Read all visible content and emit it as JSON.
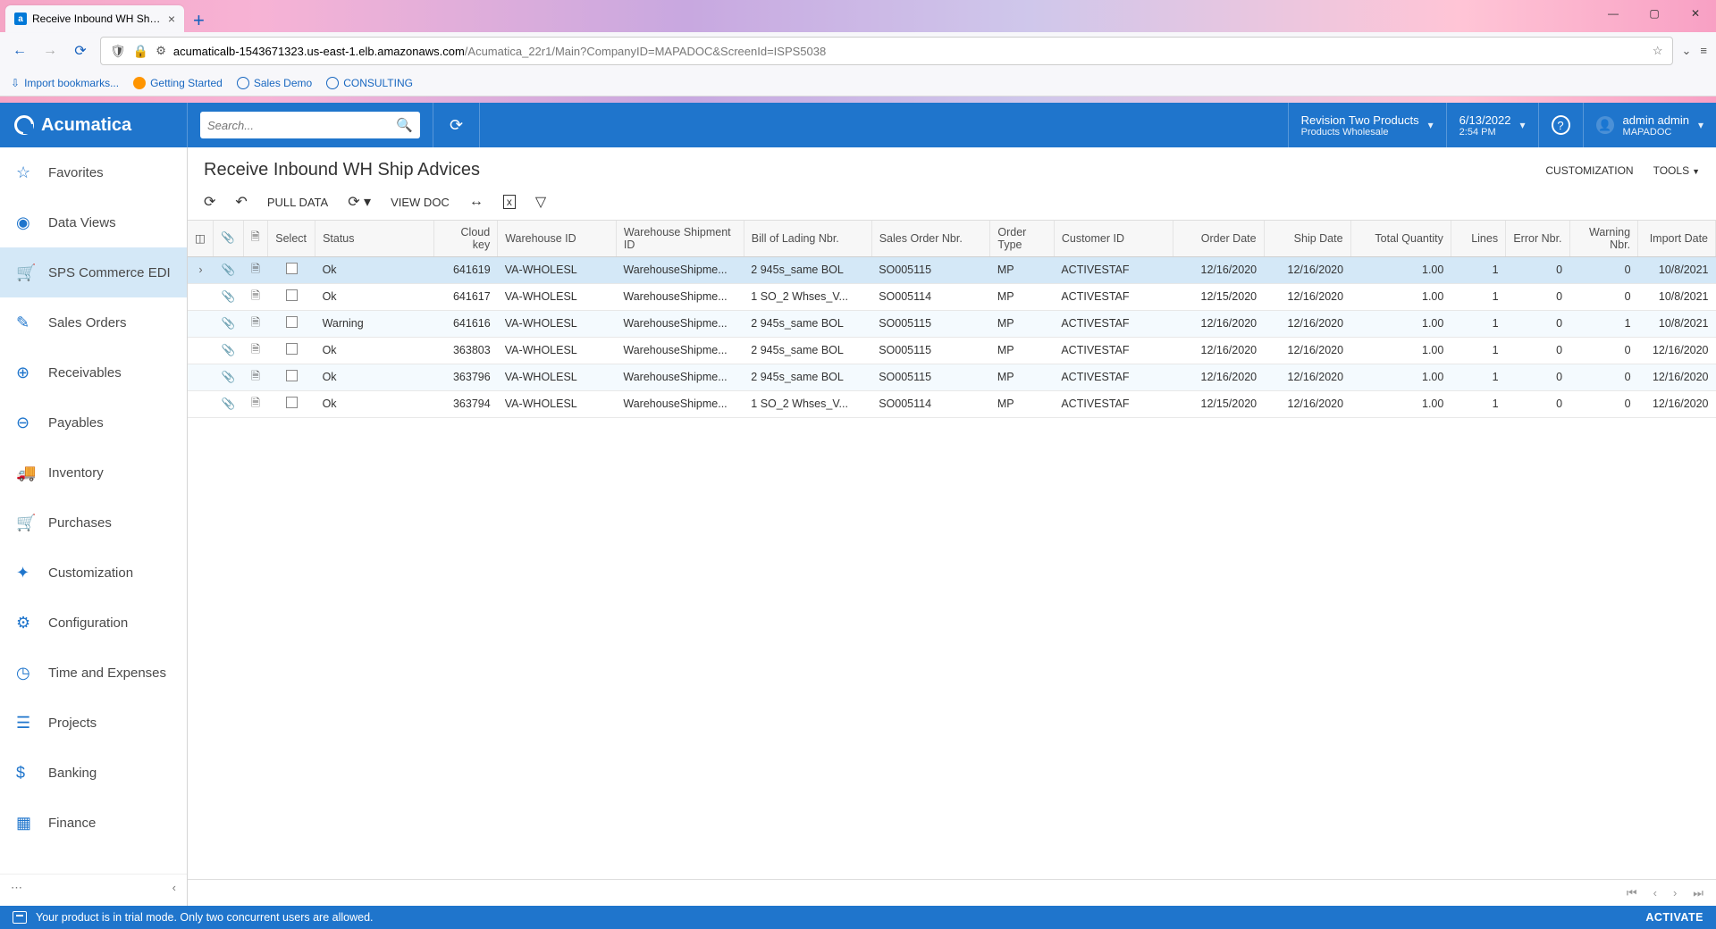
{
  "browser": {
    "tab_title": "Receive Inbound WH Ship Advi",
    "url_prefix": "acumaticalb-1543671323.us-east-1.elb.amazonaws.com",
    "url_path": "/Acumatica_22r1/Main?CompanyID=MAPADOC&ScreenId=ISPS5038",
    "bookmarks": {
      "import": "Import bookmarks...",
      "getting_started": "Getting Started",
      "sales_demo": "Sales Demo",
      "consulting": "CONSULTING"
    }
  },
  "header": {
    "logo_text": "Acumatica",
    "search_placeholder": "Search...",
    "tenant_line1": "Revision Two Products",
    "tenant_line2": "Products Wholesale",
    "date": "6/13/2022",
    "time": "2:54 PM",
    "user_line1": "admin admin",
    "user_line2": "MAPADOC"
  },
  "sidebar": {
    "items": [
      {
        "label": "Favorites",
        "icon": "star"
      },
      {
        "label": "Data Views",
        "icon": "eye"
      },
      {
        "label": "SPS Commerce EDI",
        "icon": "cart",
        "active": true
      },
      {
        "label": "Sales Orders",
        "icon": "doc"
      },
      {
        "label": "Receivables",
        "icon": "plus"
      },
      {
        "label": "Payables",
        "icon": "minus"
      },
      {
        "label": "Inventory",
        "icon": "truck"
      },
      {
        "label": "Purchases",
        "icon": "cart2"
      },
      {
        "label": "Customization",
        "icon": "puzzle"
      },
      {
        "label": "Configuration",
        "icon": "gear"
      },
      {
        "label": "Time and Expenses",
        "icon": "clock"
      },
      {
        "label": "Projects",
        "icon": "stack"
      },
      {
        "label": "Banking",
        "icon": "dollar"
      },
      {
        "label": "Finance",
        "icon": "calc"
      }
    ]
  },
  "page": {
    "title": "Receive Inbound WH Ship Advices",
    "actions": {
      "customization": "CUSTOMIZATION",
      "tools": "TOOLS"
    },
    "toolbar": {
      "pull_data": "PULL DATA",
      "view_doc": "VIEW DOC"
    }
  },
  "grid": {
    "columns": [
      "Select",
      "Status",
      "Cloud key",
      "Warehouse ID",
      "Warehouse Shipment ID",
      "Bill of Lading Nbr.",
      "Sales Order Nbr.",
      "Order Type",
      "Customer ID",
      "Order Date",
      "Ship Date",
      "Total Quantity",
      "Lines",
      "Error Nbr.",
      "Warning Nbr.",
      "Import Date"
    ],
    "rows": [
      {
        "status": "Ok",
        "cloud_key": "641619",
        "wh_id": "VA-WHOLESL",
        "wh_ship": "WarehouseShipme...",
        "bol": "2 945s_same BOL",
        "so": "SO005115",
        "otype": "MP",
        "cust": "ACTIVESTAF",
        "odate": "12/16/2020",
        "sdate": "12/16/2020",
        "qty": "1.00",
        "lines": "1",
        "err": "0",
        "warn": "0",
        "imp": "10/8/2021",
        "selected": true
      },
      {
        "status": "Ok",
        "cloud_key": "641617",
        "wh_id": "VA-WHOLESL",
        "wh_ship": "WarehouseShipme...",
        "bol": "1 SO_2 Whses_V...",
        "so": "SO005114",
        "otype": "MP",
        "cust": "ACTIVESTAF",
        "odate": "12/15/2020",
        "sdate": "12/16/2020",
        "qty": "1.00",
        "lines": "1",
        "err": "0",
        "warn": "0",
        "imp": "10/8/2021"
      },
      {
        "status": "Warning",
        "cloud_key": "641616",
        "wh_id": "VA-WHOLESL",
        "wh_ship": "WarehouseShipme...",
        "bol": "2 945s_same BOL",
        "so": "SO005115",
        "otype": "MP",
        "cust": "ACTIVESTAF",
        "odate": "12/16/2020",
        "sdate": "12/16/2020",
        "qty": "1.00",
        "lines": "1",
        "err": "0",
        "warn": "1",
        "imp": "10/8/2021"
      },
      {
        "status": "Ok",
        "cloud_key": "363803",
        "wh_id": "VA-WHOLESL",
        "wh_ship": "WarehouseShipme...",
        "bol": "2 945s_same BOL",
        "so": "SO005115",
        "otype": "MP",
        "cust": "ACTIVESTAF",
        "odate": "12/16/2020",
        "sdate": "12/16/2020",
        "qty": "1.00",
        "lines": "1",
        "err": "0",
        "warn": "0",
        "imp": "12/16/2020"
      },
      {
        "status": "Ok",
        "cloud_key": "363796",
        "wh_id": "VA-WHOLESL",
        "wh_ship": "WarehouseShipme...",
        "bol": "2 945s_same BOL",
        "so": "SO005115",
        "otype": "MP",
        "cust": "ACTIVESTAF",
        "odate": "12/16/2020",
        "sdate": "12/16/2020",
        "qty": "1.00",
        "lines": "1",
        "err": "0",
        "warn": "0",
        "imp": "12/16/2020"
      },
      {
        "status": "Ok",
        "cloud_key": "363794",
        "wh_id": "VA-WHOLESL",
        "wh_ship": "WarehouseShipme...",
        "bol": "1 SO_2 Whses_V...",
        "so": "SO005114",
        "otype": "MP",
        "cust": "ACTIVESTAF",
        "odate": "12/15/2020",
        "sdate": "12/16/2020",
        "qty": "1.00",
        "lines": "1",
        "err": "0",
        "warn": "0",
        "imp": "12/16/2020"
      }
    ]
  },
  "footer": {
    "trial_msg": "Your product is in trial mode. Only two concurrent users are allowed.",
    "activate": "ACTIVATE"
  }
}
